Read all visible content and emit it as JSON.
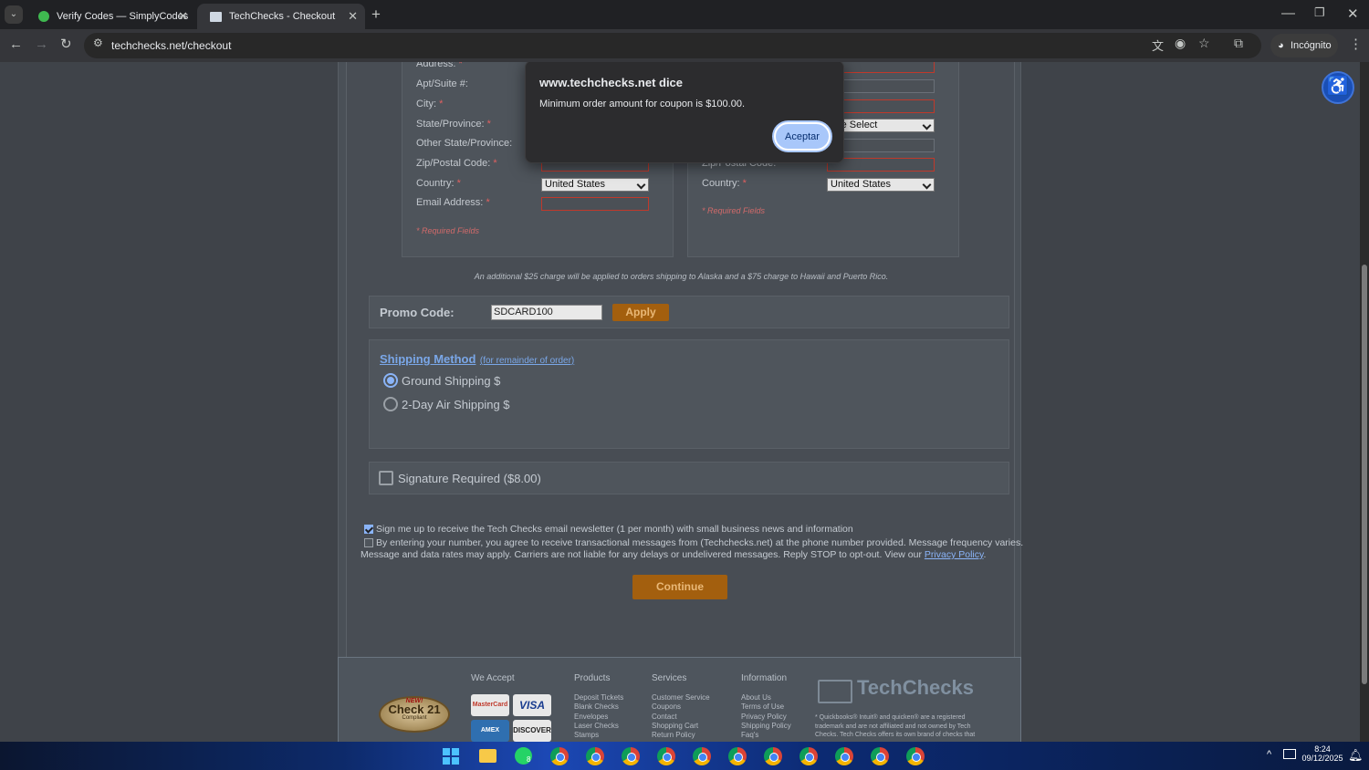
{
  "browser": {
    "tabs": [
      {
        "title": "Verify Codes — SimplyCodes"
      },
      {
        "title": "TechChecks - Checkout"
      }
    ],
    "url": "techchecks.net/checkout",
    "profile": "Incógnito"
  },
  "billing": {
    "labels": {
      "address": "Address:",
      "apt": "Apt/Suite #:",
      "city": "City:",
      "state": "State/Province:",
      "other_state": "Other State/Province:",
      "zip": "Zip/Postal Code:",
      "country": "Country:",
      "email": "Email Address:"
    },
    "required_mark": "*",
    "country_value": "United States",
    "required_note": "* Required Fields"
  },
  "shipping": {
    "labels": {
      "zip": "Zip/Postal Code:",
      "country": "Country:"
    },
    "state_value": "ase Select",
    "country_value": "United States",
    "required_note": "* Required Fields"
  },
  "surcharge_note": "An additional $25 charge will be applied to orders shipping to Alaska and a $75 charge to Hawaii and Puerto Rico.",
  "promo": {
    "label": "Promo Code:",
    "value": "SDCARD100",
    "apply": "Apply"
  },
  "shipping_method": {
    "title": "Shipping Method",
    "subtitle": "(for remainder of order)",
    "options": [
      {
        "label": "Ground Shipping $",
        "selected": true
      },
      {
        "label": "2-Day Air Shipping $",
        "selected": false
      }
    ]
  },
  "signature": {
    "label": "Signature Required ($8.00)",
    "checked": false
  },
  "newsletter": {
    "label": "Sign me up to receive the Tech Checks email newsletter (1 per month) with small business news and information",
    "checked": true
  },
  "sms": {
    "line1": "By entering your number, you agree to receive transactional messages from (Techchecks.net) at the phone number provided. Message frequency varies.",
    "line2": "Message and data rates may apply. Carriers are not liable for any delays or undelivered messages. Reply STOP to opt-out. View our",
    "link": "Privacy Policy",
    "checked": false
  },
  "continue": "Continue",
  "footer": {
    "badge": {
      "top": "NEW!",
      "main": "Check 21",
      "bottom": "Compliant"
    },
    "we_accept": "We Accept",
    "cards": [
      "MasterCard",
      "VISA",
      "AMEX",
      "DISCOVER"
    ],
    "products": {
      "title": "Products",
      "items": [
        "Deposit Tickets",
        "Blank Checks",
        "Envelopes",
        "Laser Checks",
        "Stamps"
      ]
    },
    "services": {
      "title": "Services",
      "items": [
        "Customer Service",
        "Coupons",
        "Contact",
        "Shopping Cart",
        "Return Policy"
      ]
    },
    "information": {
      "title": "Information",
      "items": [
        "About Us",
        "Terms of Use",
        "Privacy Policy",
        "Shipping Policy",
        "Faq's"
      ]
    },
    "brand": "TechChecks",
    "disclaimer": "* Quickbooks® Intuit® and quicken® are a registered trademark and are not affiliated and not owned by Tech Checks. Tech Checks offers its own brand of checks that"
  },
  "dialog": {
    "title": "www.techchecks.net dice",
    "message": "Minimum order amount for coupon is $100.00.",
    "button": "Aceptar"
  },
  "taskbar": {
    "time": "8:24",
    "date": "09/12/2025",
    "whatsapp_badge": "8"
  },
  "colors": {
    "accent_orange": "#a35f0e",
    "dialog_button": "#a8c7fa",
    "required_red": "#c0392b"
  }
}
